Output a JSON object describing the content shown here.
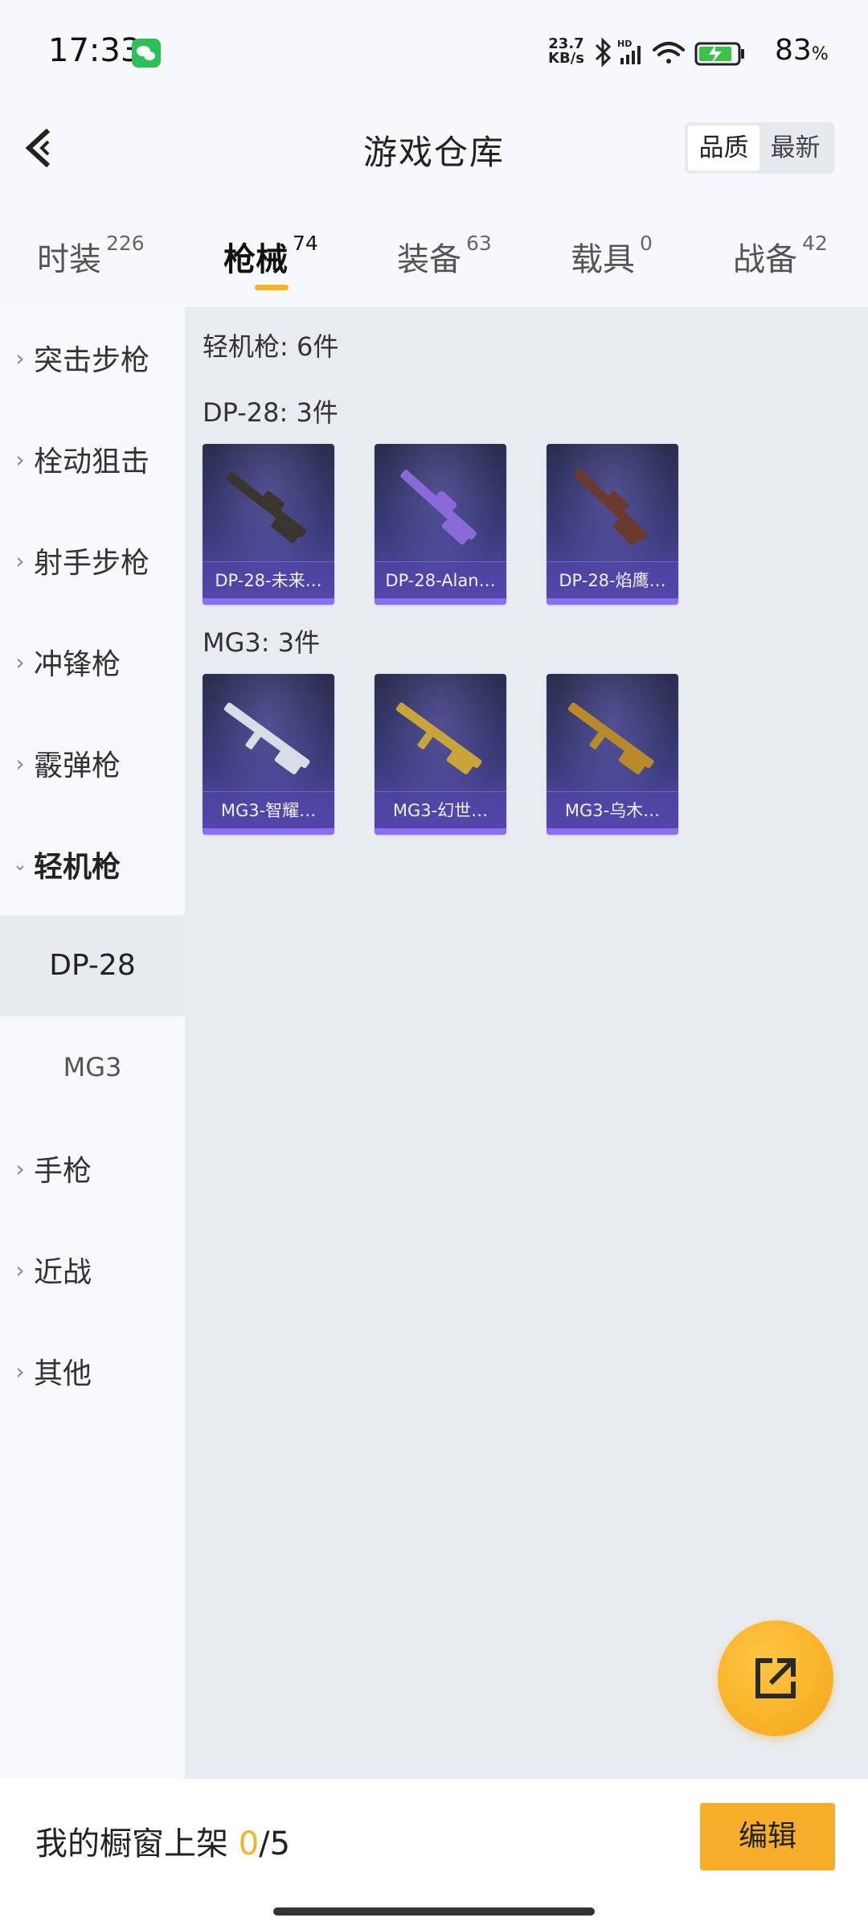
{
  "status_bar": {
    "time": "17:33",
    "net_speed_value": "23.7",
    "net_speed_unit": "KB/s",
    "battery": "83",
    "battery_unit": "%"
  },
  "header": {
    "title": "游戏仓库",
    "sort_options": [
      "品质",
      "最新"
    ],
    "sort_selected": "品质"
  },
  "tabs": [
    {
      "label": "时装",
      "count": "226"
    },
    {
      "label": "枪械",
      "count": "74",
      "active": true
    },
    {
      "label": "装备",
      "count": "63"
    },
    {
      "label": "载具",
      "count": "0"
    },
    {
      "label": "战备",
      "count": "42"
    }
  ],
  "sidebar": {
    "items": [
      {
        "label": "突击步枪"
      },
      {
        "label": "栓动狙击"
      },
      {
        "label": "射手步枪"
      },
      {
        "label": "冲锋枪"
      },
      {
        "label": "霰弹枪"
      },
      {
        "label": "轻机枪",
        "expanded": true
      },
      {
        "label": "手枪"
      },
      {
        "label": "近战"
      },
      {
        "label": "其他"
      }
    ],
    "sub_items": [
      {
        "label": "DP-28",
        "active": true
      },
      {
        "label": "MG3"
      }
    ]
  },
  "content": {
    "category_summary": "轻机枪: 6件",
    "groups": [
      {
        "title": "DP-28: 3件",
        "items": [
          {
            "name": "DP-28-未来…",
            "palette": "#3b3530"
          },
          {
            "name": "DP-28-Alan…",
            "palette": "#8a6ad8"
          },
          {
            "name": "DP-28-焰鹰…",
            "palette": "#6b3a2e"
          }
        ]
      },
      {
        "title": "MG3: 3件",
        "items": [
          {
            "name": "MG3-智耀…",
            "palette": "#d8dce4"
          },
          {
            "name": "MG3-幻世…",
            "palette": "#c9a43a"
          },
          {
            "name": "MG3-乌木…",
            "palette": "#b98a2a"
          }
        ]
      }
    ]
  },
  "bottom_bar": {
    "label": "我的橱窗上架",
    "current": "0",
    "total": "/5",
    "edit_label": "编辑"
  },
  "colors": {
    "accent": "#f5b324",
    "card_rarity": "#8d6ef0"
  },
  "icons": {
    "back": "chevron-left-icon",
    "fab": "share-external-icon"
  }
}
